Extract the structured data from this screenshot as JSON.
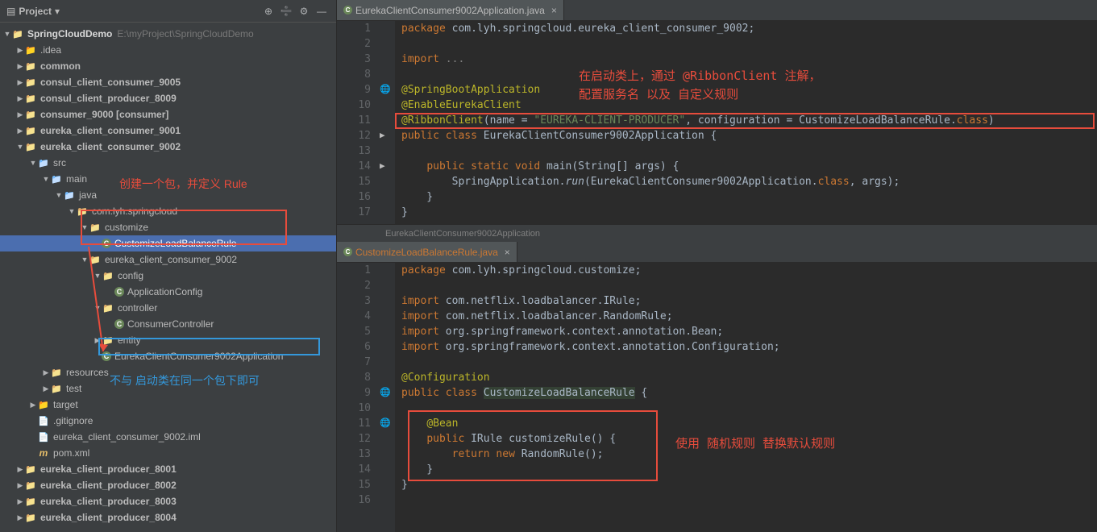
{
  "sidebar": {
    "title": "Project",
    "root": {
      "name": "SpringCloudDemo",
      "path": "E:\\myProject\\SpringCloudDemo"
    },
    "tree": [
      {
        "depth": 1,
        "arrow": "collapsed",
        "icon": "folder orange",
        "label": ".idea"
      },
      {
        "depth": 1,
        "arrow": "collapsed",
        "icon": "folder",
        "label": "common",
        "bold": true
      },
      {
        "depth": 1,
        "arrow": "collapsed",
        "icon": "folder",
        "label": "consul_client_consumer_9005",
        "bold": true
      },
      {
        "depth": 1,
        "arrow": "collapsed",
        "icon": "folder",
        "label": "consul_client_producer_8009",
        "bold": true
      },
      {
        "depth": 1,
        "arrow": "collapsed",
        "icon": "folder",
        "label": "consumer_9000 [consumer]",
        "bold": true
      },
      {
        "depth": 1,
        "arrow": "collapsed",
        "icon": "folder",
        "label": "eureka_client_consumer_9001",
        "bold": true
      },
      {
        "depth": 1,
        "arrow": "expanded",
        "icon": "folder",
        "label": "eureka_client_consumer_9002",
        "bold": true
      },
      {
        "depth": 2,
        "arrow": "expanded",
        "icon": "folder blue",
        "label": "src"
      },
      {
        "depth": 3,
        "arrow": "expanded",
        "icon": "folder blue",
        "label": "main"
      },
      {
        "depth": 4,
        "arrow": "expanded",
        "icon": "folder blue",
        "label": "java"
      },
      {
        "depth": 5,
        "arrow": "expanded",
        "icon": "folder",
        "label": "com.lyh.springcloud"
      },
      {
        "depth": 6,
        "arrow": "expanded",
        "icon": "folder",
        "label": "customize"
      },
      {
        "depth": 7,
        "arrow": "none",
        "icon": "java",
        "label": "CustomizeLoadBalanceRule",
        "selected": true
      },
      {
        "depth": 6,
        "arrow": "expanded",
        "icon": "folder",
        "label": "eureka_client_consumer_9002"
      },
      {
        "depth": 7,
        "arrow": "expanded",
        "icon": "folder",
        "label": "config"
      },
      {
        "depth": 8,
        "arrow": "none",
        "icon": "java",
        "label": "ApplicationConfig"
      },
      {
        "depth": 7,
        "arrow": "expanded",
        "icon": "folder",
        "label": "controller"
      },
      {
        "depth": 8,
        "arrow": "none",
        "icon": "java",
        "label": "ConsumerController"
      },
      {
        "depth": 7,
        "arrow": "collapsed",
        "icon": "folder",
        "label": "entity"
      },
      {
        "depth": 7,
        "arrow": "none",
        "icon": "java",
        "label": "EurekaClientConsumer9002Application"
      },
      {
        "depth": 3,
        "arrow": "collapsed",
        "icon": "folder",
        "label": "resources"
      },
      {
        "depth": 3,
        "arrow": "collapsed",
        "icon": "folder",
        "label": "test"
      },
      {
        "depth": 2,
        "arrow": "collapsed",
        "icon": "folder orange",
        "label": "target"
      },
      {
        "depth": 2,
        "arrow": "none",
        "icon": "gitignore",
        "label": ".gitignore"
      },
      {
        "depth": 2,
        "arrow": "none",
        "icon": "iml",
        "label": "eureka_client_consumer_9002.iml"
      },
      {
        "depth": 2,
        "arrow": "none",
        "icon": "pom",
        "label": "pom.xml"
      },
      {
        "depth": 1,
        "arrow": "collapsed",
        "icon": "folder",
        "label": "eureka_client_producer_8001",
        "bold": true
      },
      {
        "depth": 1,
        "arrow": "collapsed",
        "icon": "folder",
        "label": "eureka_client_producer_8002",
        "bold": true
      },
      {
        "depth": 1,
        "arrow": "collapsed",
        "icon": "folder",
        "label": "eureka_client_producer_8003",
        "bold": true
      },
      {
        "depth": 1,
        "arrow": "collapsed",
        "icon": "folder",
        "label": "eureka_client_producer_8004",
        "bold": true
      }
    ]
  },
  "annotations": {
    "red_text_1": "创建一个包，并定义 Rule",
    "blue_text_1": "不与 启动类在同一个包下即可",
    "red_text_2_line1": "在启动类上，通过 @RibbonClient 注解，",
    "red_text_2_line2": "配置服务名 以及 自定义规则",
    "red_text_3": "使用 随机规则 替换默认规则"
  },
  "editor1": {
    "tab": "EurekaClientConsumer9002Application.java",
    "breadcrumb": "EurekaClientConsumer9002Application",
    "lines": [
      {
        "n": 1,
        "html": "<span class='kw'>package</span> com.lyh.springcloud.eureka_client_consumer_9002;"
      },
      {
        "n": 2,
        "html": ""
      },
      {
        "n": 3,
        "html": "<span class='kw'>import</span> <span class='comment'>...</span>"
      },
      {
        "n": 8,
        "html": ""
      },
      {
        "n": 9,
        "html": "<span class='ann'>@SpringBootApplication</span>",
        "gutter": "🌐"
      },
      {
        "n": 10,
        "html": "<span class='ann'>@EnableEurekaClient</span>"
      },
      {
        "n": 11,
        "html": "<span class='ann'>@RibbonClient</span>(name = <span class='str'>\"EUREKA-CLIENT-PRODUCER\"</span>, configuration = CustomizeLoadBalanceRule.<span class='kw'>class</span>)"
      },
      {
        "n": 12,
        "html": "<span class='kw'>public class</span> EurekaClientConsumer9002Application {",
        "gutter": "▶"
      },
      {
        "n": 13,
        "html": ""
      },
      {
        "n": 14,
        "html": "    <span class='kw'>public static void</span> main(String[] args) {",
        "gutter": "▶"
      },
      {
        "n": 15,
        "html": "        SpringApplication.<span class='static-hl'>run</span>(EurekaClientConsumer9002Application.<span class='kw'>class</span>, args);"
      },
      {
        "n": 16,
        "html": "    }"
      },
      {
        "n": 17,
        "html": "}"
      }
    ]
  },
  "editor2": {
    "tab": "CustomizeLoadBalanceRule.java",
    "lines": [
      {
        "n": 1,
        "html": "<span class='kw'>package</span> com.lyh.springcloud.customize;"
      },
      {
        "n": 2,
        "html": ""
      },
      {
        "n": 3,
        "html": "<span class='kw'>import</span> com.netflix.loadbalancer.IRule;"
      },
      {
        "n": 4,
        "html": "<span class='kw'>import</span> com.netflix.loadbalancer.RandomRule;"
      },
      {
        "n": 5,
        "html": "<span class='kw'>import</span> org.springframework.context.annotation.<span class='cls'>Bean</span>;"
      },
      {
        "n": 6,
        "html": "<span class='kw'>import</span> org.springframework.context.annotation.Configuration;"
      },
      {
        "n": 7,
        "html": ""
      },
      {
        "n": 8,
        "html": "<span class='ann'>@Configuration</span>"
      },
      {
        "n": 9,
        "html": "<span class='kw'>public class</span> <span style='background:#344134;'>CustomizeLoadBalanceRule</span> {",
        "gutter": "🌐"
      },
      {
        "n": 10,
        "html": ""
      },
      {
        "n": 11,
        "html": "    <span class='ann'>@Bean</span>",
        "gutter": "🌐"
      },
      {
        "n": 12,
        "html": "    <span class='kw'>public</span> IRule customizeRule() {"
      },
      {
        "n": 13,
        "html": "        <span class='kw'>return new</span> RandomRule();"
      },
      {
        "n": 14,
        "html": "    }"
      },
      {
        "n": 15,
        "html": "}"
      },
      {
        "n": 16,
        "html": ""
      }
    ]
  }
}
